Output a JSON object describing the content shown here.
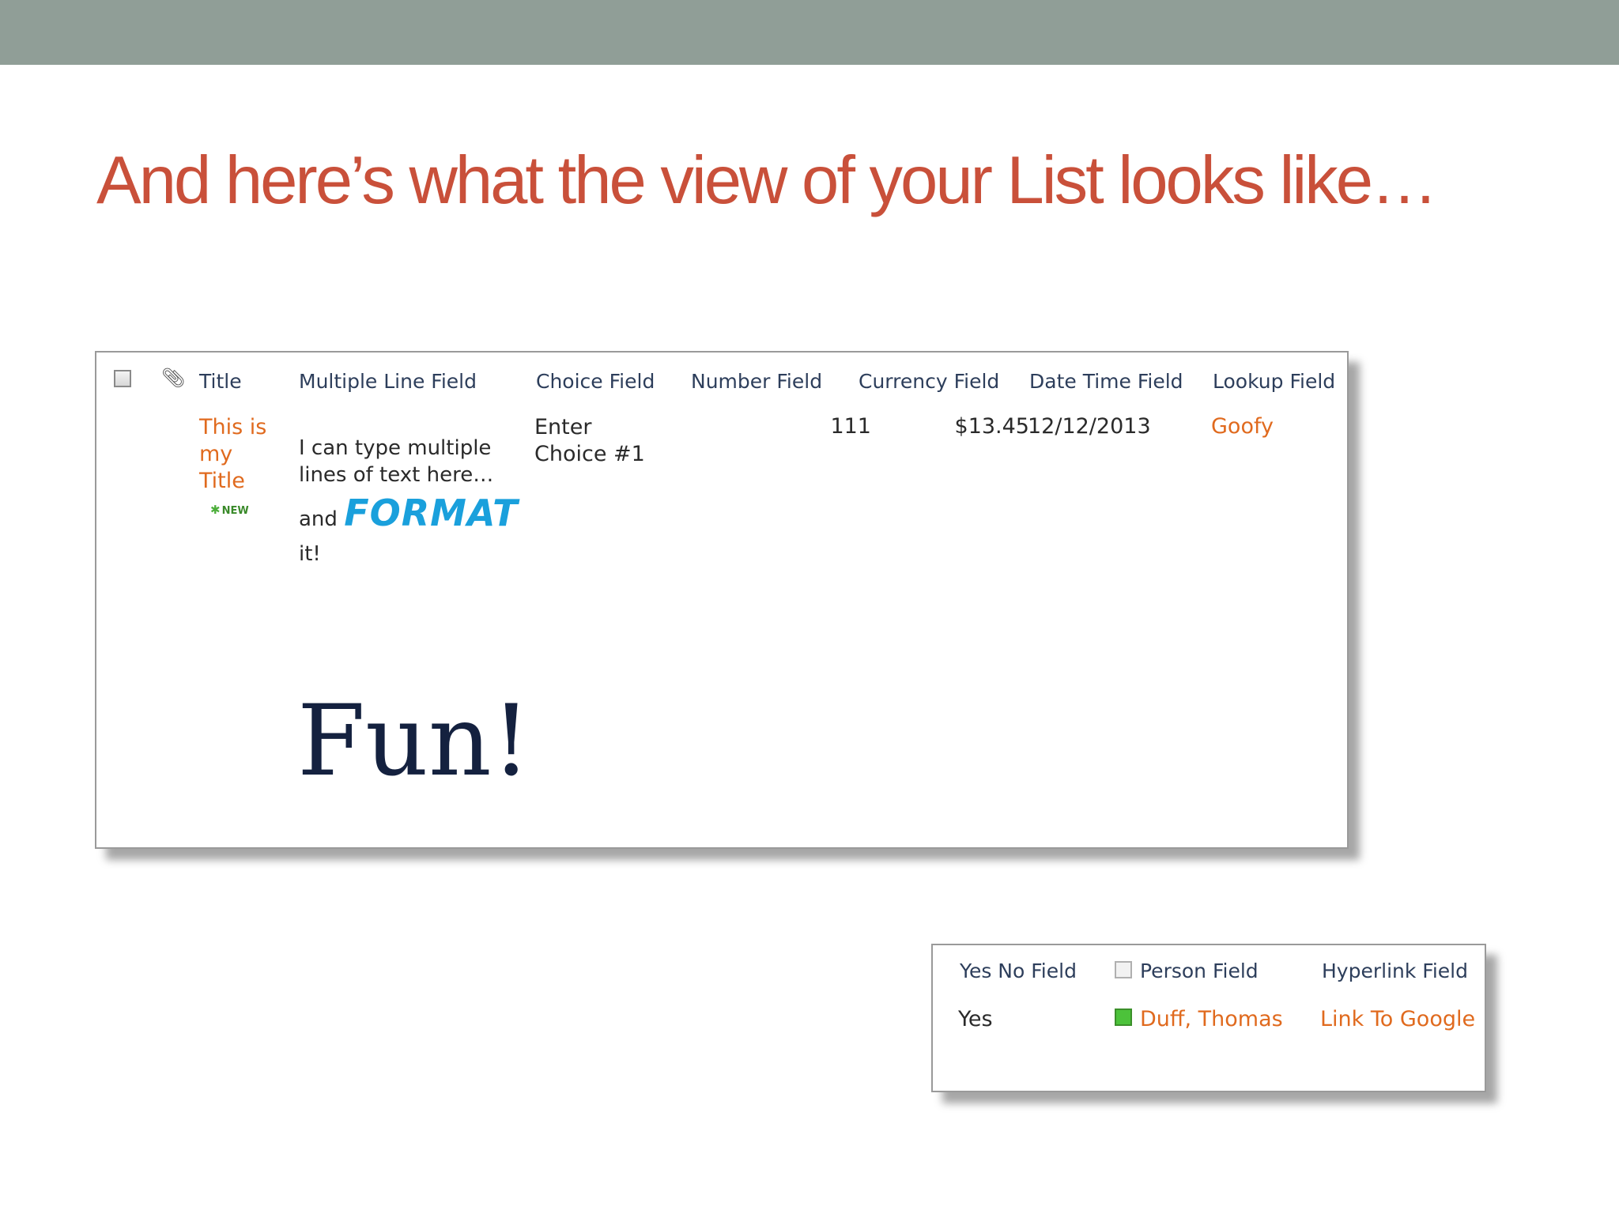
{
  "slide": {
    "title": "And here’s what the view of your List looks like…"
  },
  "list_view": {
    "headers": {
      "title": "Title",
      "multiple_line": "Multiple Line Field",
      "choice": "Choice Field",
      "number": "Number Field",
      "currency": "Currency Field",
      "datetime": "Date Time Field",
      "lookup": "Lookup Field"
    },
    "row": {
      "title": "This is my Title",
      "new_badge": "NEW",
      "multiline": {
        "line1": "I can type multiple",
        "line2": "lines of text here…",
        "and": "and",
        "format": "FORMAT",
        "it": "it!",
        "fun": "Fun!"
      },
      "choice": "Enter Choice #1",
      "number": "111",
      "currency": "$13.45",
      "datetime": "12/12/2013",
      "lookup": "Goofy"
    }
  },
  "extra_view": {
    "headers": {
      "yes_no": "Yes No Field",
      "person": "Person Field",
      "hyperlink": "Hyperlink Field"
    },
    "row": {
      "yes_no": "Yes",
      "person": "Duff, Thomas",
      "hyperlink": "Link To Google"
    }
  },
  "colors": {
    "title": "#c9503a",
    "link": "#e06a1e",
    "header_text": "#2d3e5b",
    "format_text": "#1aa0dc",
    "fun_text": "#14213f",
    "top_bar": "#909e97"
  },
  "icons": [
    "checkbox-icon",
    "paperclip-icon",
    "new-star-icon",
    "presence-icon"
  ]
}
